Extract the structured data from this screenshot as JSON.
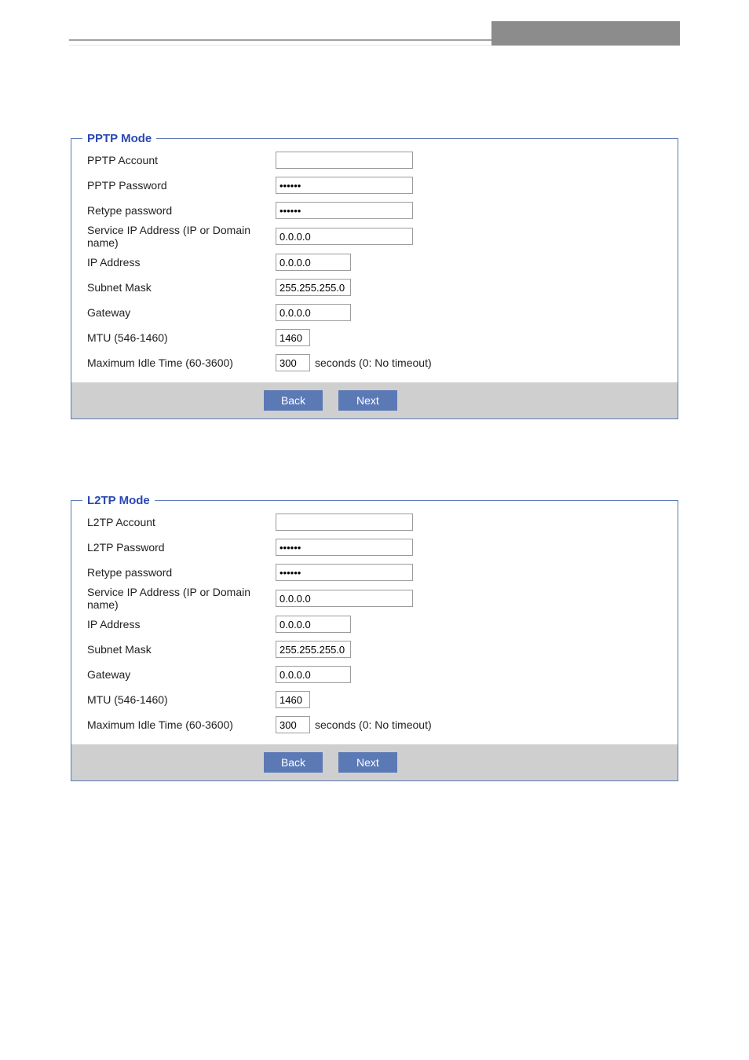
{
  "pptp": {
    "legend": "PPTP Mode",
    "labels": {
      "account": "PPTP Account",
      "password": "PPTP Password",
      "retype": "Retype password",
      "service_ip": "Service IP Address (IP or Domain name)",
      "ip": "IP Address",
      "subnet": "Subnet Mask",
      "gateway": "Gateway",
      "mtu": "MTU (546-1460)",
      "max_idle": "Maximum Idle Time (60-3600)"
    },
    "values": {
      "account": "",
      "password": "••••••",
      "retype": "••••••",
      "service_ip": "0.0.0.0",
      "ip": "0.0.0.0",
      "subnet": "255.255.255.0",
      "gateway": "0.0.0.0",
      "mtu": "1460",
      "max_idle": "300"
    },
    "idle_suffix": "seconds (0: No timeout)",
    "buttons": {
      "back": "Back",
      "next": "Next"
    }
  },
  "l2tp": {
    "legend": "L2TP Mode",
    "labels": {
      "account": "L2TP Account",
      "password": "L2TP Password",
      "retype": "Retype password",
      "service_ip": "Service IP Address (IP or Domain name)",
      "ip": "IP Address",
      "subnet": "Subnet Mask",
      "gateway": "Gateway",
      "mtu": "MTU (546-1460)",
      "max_idle": "Maximum Idle Time (60-3600)"
    },
    "values": {
      "account": "",
      "password": "••••••",
      "retype": "••••••",
      "service_ip": "0.0.0.0",
      "ip": "0.0.0.0",
      "subnet": "255.255.255.0",
      "gateway": "0.0.0.0",
      "mtu": "1460",
      "max_idle": "300"
    },
    "idle_suffix": "seconds (0: No timeout)",
    "buttons": {
      "back": "Back",
      "next": "Next"
    }
  }
}
